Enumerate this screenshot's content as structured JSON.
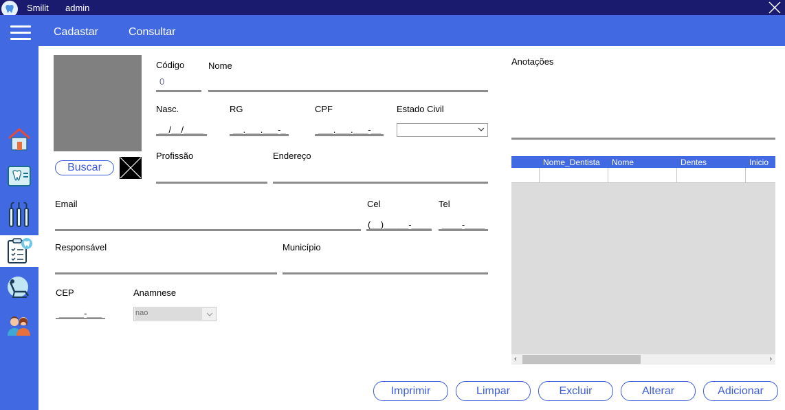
{
  "window": {
    "app_title": "Smilit",
    "user": "admin"
  },
  "topnav": {
    "cadastrar": "Cadastar",
    "consultar": "Consultar"
  },
  "sidebar": {
    "items": [
      {
        "icon": "house-icon"
      },
      {
        "icon": "tooth-xray-icon"
      },
      {
        "icon": "dental-tools-icon"
      },
      {
        "icon": "clipboard-tooth-icon",
        "active": true
      },
      {
        "icon": "dental-chair-icon"
      },
      {
        "icon": "people-icon"
      }
    ]
  },
  "form": {
    "codigo": {
      "label": "Código",
      "value": "0"
    },
    "nome": {
      "label": "Nome",
      "value": ""
    },
    "nasc": {
      "label": "Nasc.",
      "mask": "__/__/____"
    },
    "rg": {
      "label": "RG",
      "mask": "__.___.___-_"
    },
    "cpf": {
      "label": "CPF",
      "mask": "___.___.___-__"
    },
    "estado_civil": {
      "label": "Estado Civil",
      "value": ""
    },
    "profissao": {
      "label": "Profissão",
      "value": ""
    },
    "endereco": {
      "label": "Endereço",
      "value": ""
    },
    "email": {
      "label": "Email",
      "value": ""
    },
    "cel": {
      "label": "Cel",
      "mask": "(__)_____-____"
    },
    "tel": {
      "label": "Tel",
      "mask": "____-____"
    },
    "responsavel": {
      "label": "Responsável",
      "value": ""
    },
    "municipio": {
      "label": "Município",
      "value": ""
    },
    "cep": {
      "label": "CEP",
      "mask": "_____-___"
    },
    "anamnese": {
      "label": "Anamnese",
      "value": "nao"
    },
    "buscar": "Buscar",
    "anotacoes": {
      "label": "Anotações",
      "value": ""
    }
  },
  "grid": {
    "columns": [
      "Nome_Dentista",
      "Nome",
      "Dentes",
      "Inicio"
    ],
    "new_row_marker": "*"
  },
  "actions": {
    "imprimir": "Imprimir",
    "limpar": "Limpar",
    "excluir": "Excluir",
    "alterar": "Alterar",
    "adicionar": "Adicionar"
  },
  "colors": {
    "primary": "#4169e1",
    "titlebar": "#1a1a6e",
    "accent": "#3b5bdb"
  }
}
